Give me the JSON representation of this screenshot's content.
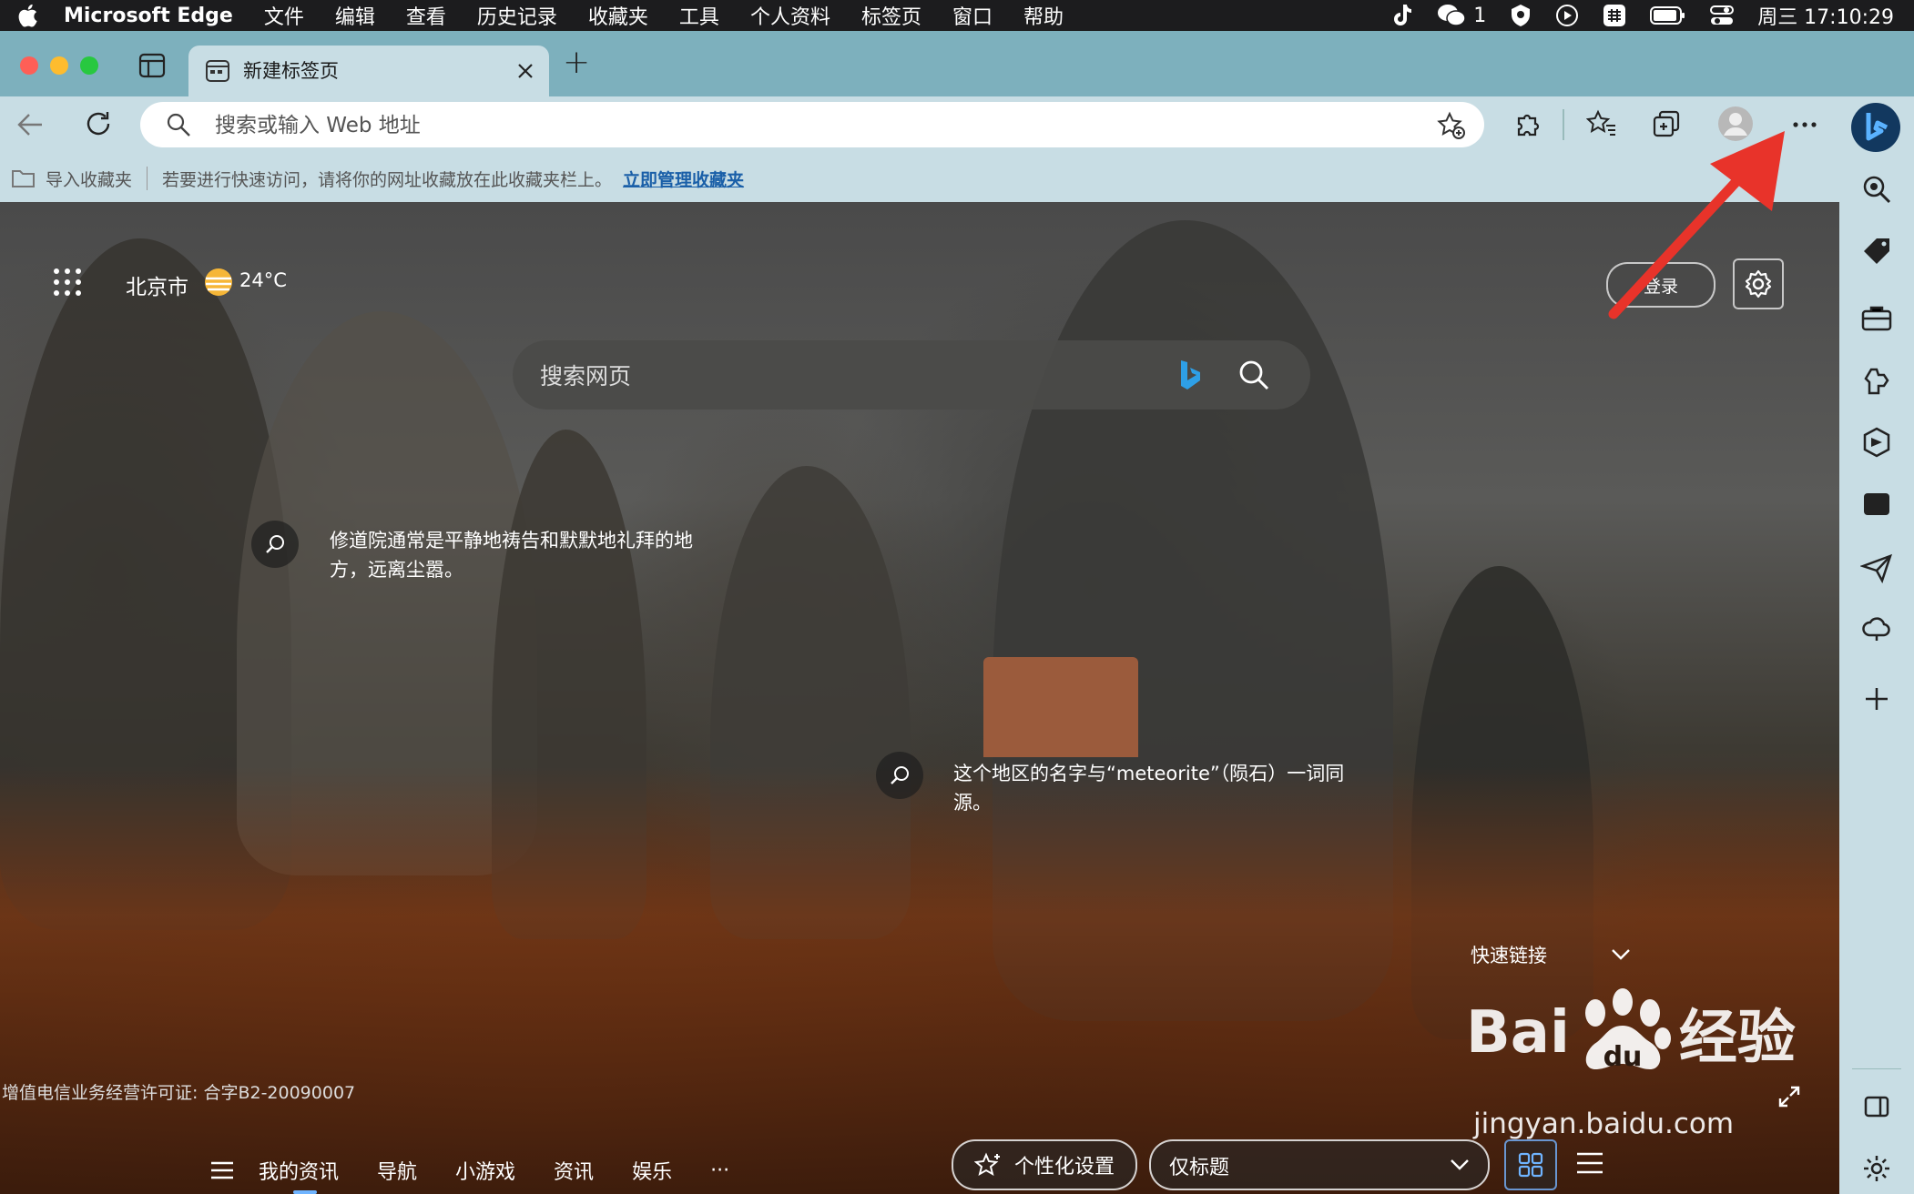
{
  "menubar": {
    "app_name": "Microsoft Edge",
    "menus": [
      "文件",
      "编辑",
      "查看",
      "历史记录",
      "收藏夹",
      "工具",
      "个人资料",
      "标签页",
      "窗口",
      "帮助"
    ],
    "wechat_count": "1",
    "clock": "周三 17:10:29"
  },
  "tabs": {
    "active_title": "新建标签页",
    "new_tab_label": "+"
  },
  "toolbar": {
    "address_placeholder": "搜索或输入 Web 地址"
  },
  "favbar": {
    "import_label": "导入收藏夹",
    "hint": "若要进行快速访问，请将你的网址收藏放在此收藏夹栏上。",
    "manage_link": "立即管理收藏夹"
  },
  "newtab": {
    "city": "北京市",
    "temperature": "24°C",
    "login_label": "登录",
    "search_placeholder": "搜索网页",
    "hotspot1": "修道院通常是平静地祷告和默默地礼拜的地方，远离尘嚣。",
    "hotspot2": "这个地区的名字与“meteorite”（陨石）一词同源。",
    "quick_links": "快速链接",
    "license": "增值电信业务经营许可证: 合字B2-20090007"
  },
  "feed": {
    "tabs": [
      "我的资讯",
      "导航",
      "小游戏",
      "资讯",
      "娱乐"
    ],
    "more": "···",
    "personalize": "个性化设置",
    "layout_option": "仅标题"
  },
  "watermark": {
    "brand": "Bai",
    "brand_cn": "经验",
    "url": "jingyan.baidu.com"
  },
  "colors": {
    "chrome": "#c8dde4",
    "tabstrip": "#7db0bd",
    "link": "#1a5fa8",
    "arrow": "#e8332a"
  }
}
